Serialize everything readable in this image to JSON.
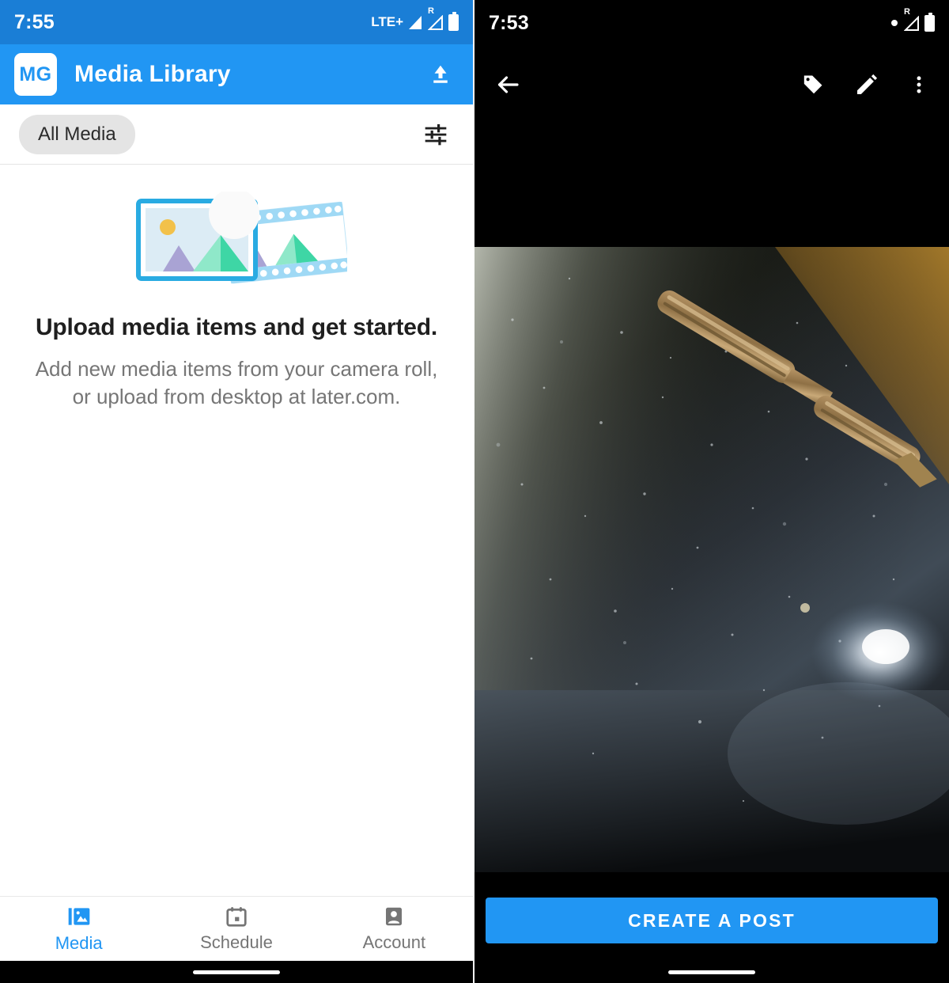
{
  "left_screen": {
    "status_bar": {
      "time": "7:55",
      "network_label": "LTE+",
      "roaming_label": "R",
      "icons": [
        "signal-icon",
        "roaming-signal-icon",
        "battery-icon"
      ]
    },
    "app_bar": {
      "avatar_initials": "MG",
      "title": "Media Library",
      "upload_icon": "upload-icon"
    },
    "filter_bar": {
      "chip_label": "All Media",
      "tune_icon": "tune-icon"
    },
    "empty_state": {
      "illustration": "media-placeholder-illustration",
      "title": "Upload media items and get started.",
      "subtitle": "Add new media items from your camera roll, or upload from desktop at later.com."
    },
    "bottom_nav": {
      "items": [
        {
          "label": "Media",
          "icon": "photo-library-icon",
          "active": true
        },
        {
          "label": "Schedule",
          "icon": "calendar-icon",
          "active": false
        },
        {
          "label": "Account",
          "icon": "person-badge-icon",
          "active": false
        }
      ]
    }
  },
  "right_screen": {
    "status_bar": {
      "time": "7:53",
      "roaming_label": "R",
      "icons": [
        "dot-icon",
        "roaming-signal-icon",
        "battery-icon"
      ]
    },
    "top_bar": {
      "back_icon": "back-arrow-icon",
      "actions": [
        "tag-icon",
        "edit-pencil-icon",
        "overflow-menu-icon"
      ]
    },
    "photo": {
      "description": "Macro close-up photograph of a small copper metal clip on a dark dusty surface"
    },
    "cta": {
      "label": "CREATE A POST"
    }
  },
  "colors": {
    "status_bar_blue": "#1a7ed6",
    "app_bar_blue": "#2196f3",
    "accent_blue": "#2196f3",
    "chip_gray": "#e4e4e4",
    "title_text": "#1f1f1f",
    "subtitle_text": "#767676",
    "nav_inactive": "#757575",
    "illustration_frame": "#29abe2",
    "illustration_sky": "#dcecf5",
    "illustration_sun": "#f2c14a",
    "illustration_mtn_purple": "#a9a3d4",
    "illustration_mtn_teal": "#3ed6a5",
    "illustration_mtn_teal_light": "#8fe8c9",
    "black": "#000000",
    "white": "#ffffff"
  }
}
